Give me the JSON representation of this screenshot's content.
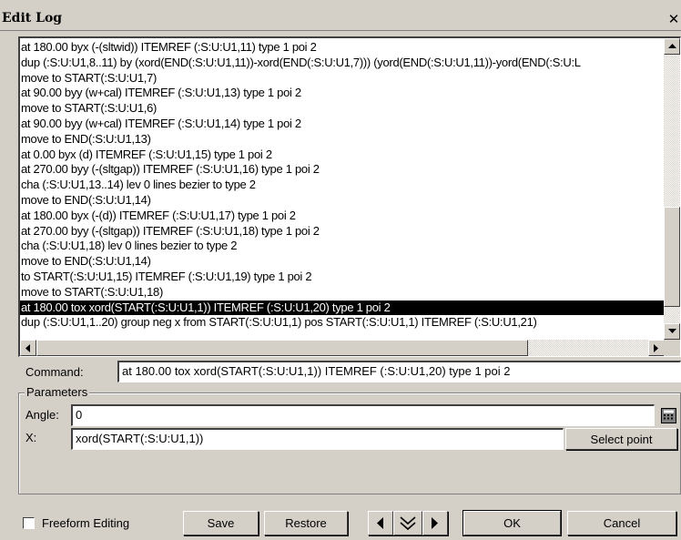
{
  "window": {
    "title": "Edit Log",
    "close_glyph": "✕"
  },
  "log": {
    "lines": [
      "at 180.00 byx (-(sltwid)) ITEMREF (:S:U:U1,11) type 1 poi 2",
      "dup (:S:U:U1,8..11) by (xord(END(:S:U:U1,11))-xord(END(:S:U:U1,7))) (yord(END(:S:U:U1,11))-yord(END(:S:U:L",
      "move to START(:S:U:U1,7)",
      "at 90.00 byy (w+cal) ITEMREF (:S:U:U1,13) type 1 poi 2",
      "move to START(:S:U:U1,6)",
      "at 90.00 byy (w+cal) ITEMREF (:S:U:U1,14) type 1 poi 2",
      "move to END(:S:U:U1,13)",
      "at 0.00 byx (d) ITEMREF (:S:U:U1,15) type 1 poi 2",
      "at 270.00 byy (-(sltgap)) ITEMREF (:S:U:U1,16) type 1 poi 2",
      "cha (:S:U:U1,13..14) lev 0 lines bezier to type 2",
      "move to END(:S:U:U1,14)",
      "at 180.00 byx (-(d)) ITEMREF (:S:U:U1,17) type 1 poi 2",
      "at 270.00 byy (-(sltgap)) ITEMREF (:S:U:U1,18) type 1 poi 2",
      "cha (:S:U:U1,18) lev 0 lines bezier to type 2",
      "move to END(:S:U:U1,14)",
      "to START(:S:U:U1,15) ITEMREF (:S:U:U1,19) type 1 poi 2",
      "move to START(:S:U:U1,18)",
      "at 180.00 tox xord(START(:S:U:U1,1)) ITEMREF (:S:U:U1,20) type 1 poi 2",
      "dup (:S:U:U1,1..20) group neg x from START(:S:U:U1,1) pos START(:S:U:U1,1) ITEMREF (:S:U:U1,21)"
    ],
    "selected_index": 17
  },
  "command": {
    "label": "Command:",
    "value": "at 180.00 tox xord(START(:S:U:U1,1)) ITEMREF (:S:U:U1,20) type 1 poi 2"
  },
  "parameters": {
    "legend": "Parameters",
    "angle_label": "Angle:",
    "angle_value": "0",
    "x_label": "X:",
    "x_value": "xord(START(:S:U:U1,1))",
    "select_point_label": "Select point"
  },
  "footer": {
    "freeform_label": "Freeform Editing",
    "freeform_checked": false,
    "save_label": "Save",
    "restore_label": "Restore",
    "ok_label": "OK",
    "cancel_label": "Cancel"
  },
  "icons": {
    "close": "close-icon",
    "scroll_up": "arrow-up-icon",
    "scroll_down": "arrow-down-icon",
    "scroll_left": "arrow-left-icon",
    "scroll_right": "arrow-right-icon",
    "calculator": "calculator-icon",
    "nav_prev": "arrow-left-icon",
    "nav_down": "double-chevron-down-icon",
    "nav_next": "arrow-right-icon"
  },
  "colors": {
    "selection_bg": "#000000",
    "selection_fg": "#ffffff",
    "face": "#d4d0c8"
  }
}
